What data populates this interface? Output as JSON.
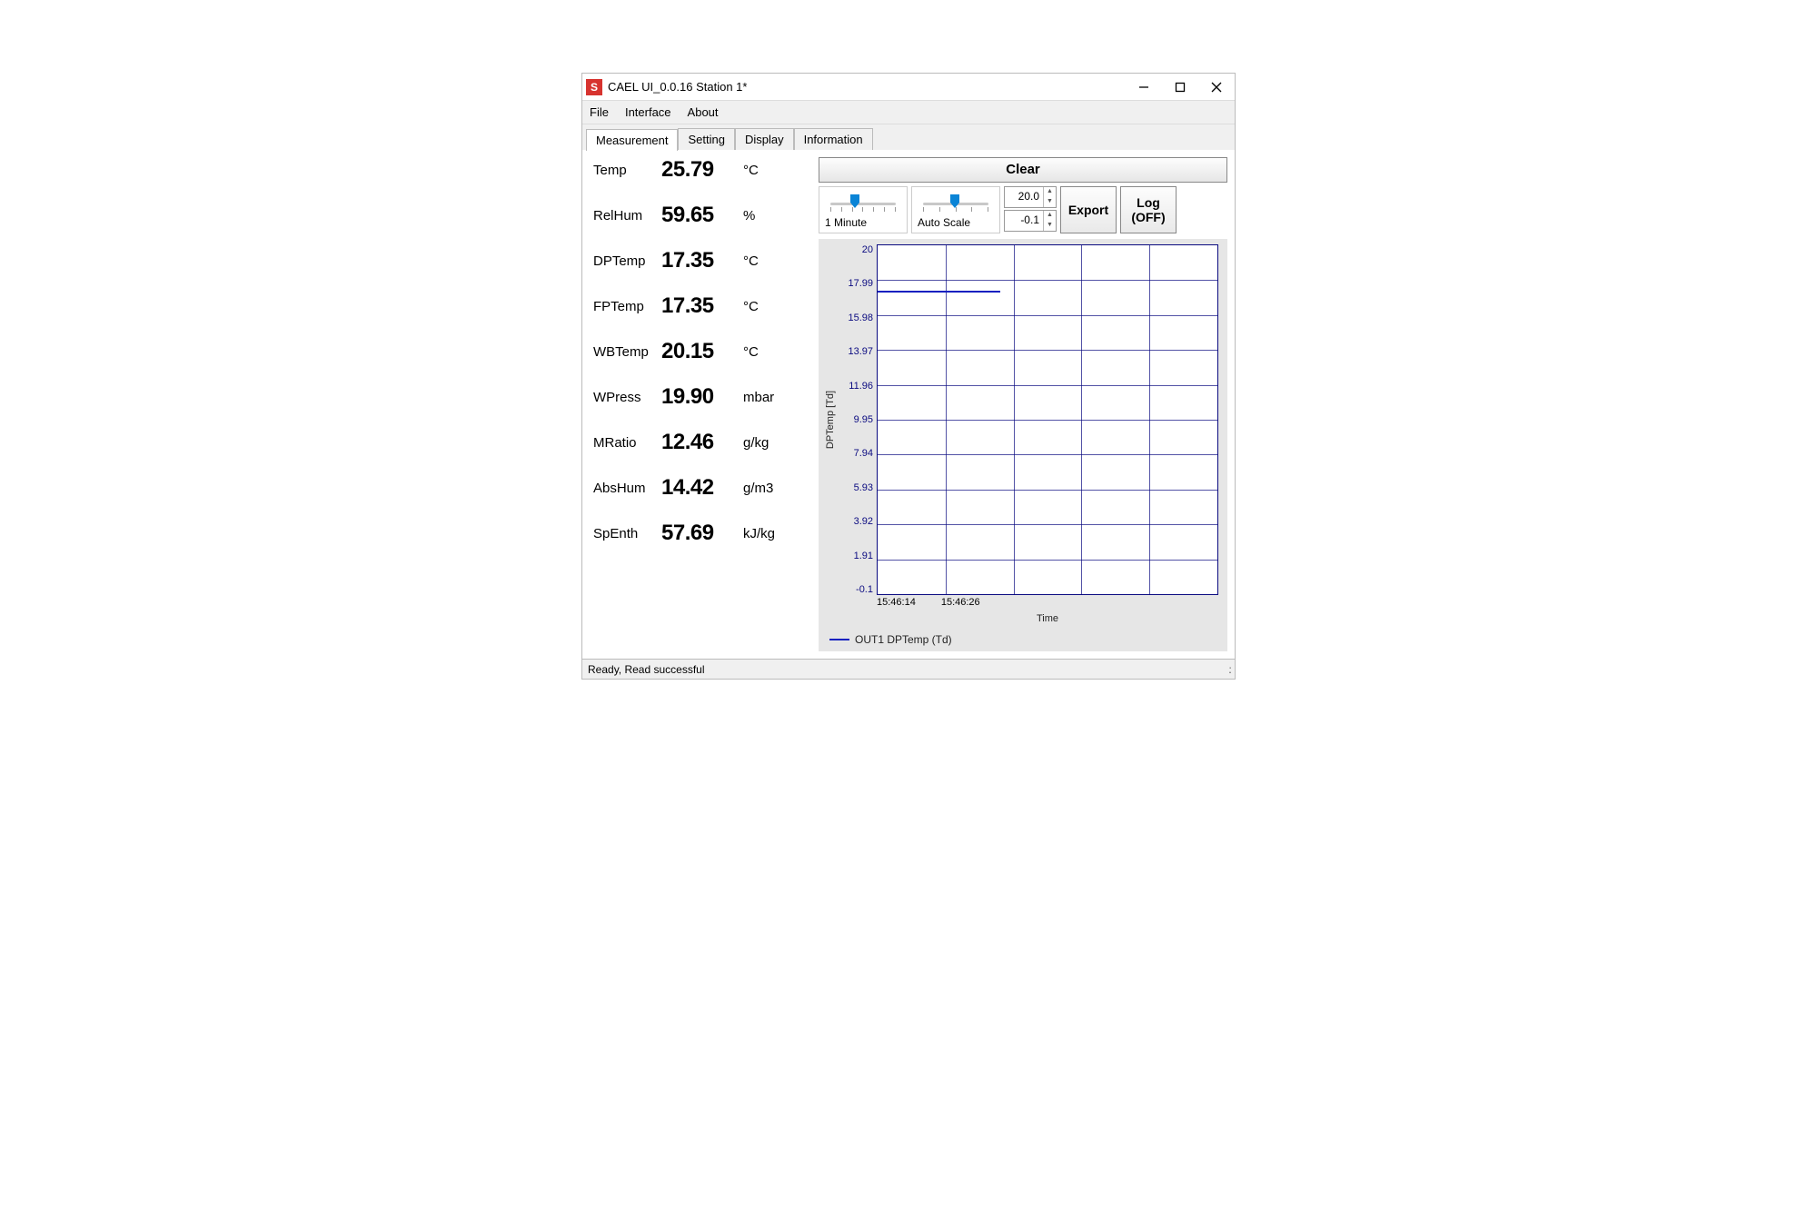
{
  "window": {
    "app_icon_letter": "S",
    "title": "CAEL UI_0.0.16  Station 1*"
  },
  "menu": {
    "items": [
      "File",
      "Interface",
      "About"
    ]
  },
  "tabs": {
    "items": [
      "Measurement",
      "Setting",
      "Display",
      "Information"
    ],
    "active": 0
  },
  "measurements": [
    {
      "label": "Temp",
      "value": "25.79",
      "unit": "°C"
    },
    {
      "label": "RelHum",
      "value": "59.65",
      "unit": "%"
    },
    {
      "label": "DPTemp",
      "value": "17.35",
      "unit": "°C"
    },
    {
      "label": "FPTemp",
      "value": "17.35",
      "unit": "°C"
    },
    {
      "label": "WBTemp",
      "value": "20.15",
      "unit": "°C"
    },
    {
      "label": "WPress",
      "value": "19.90",
      "unit": "mbar"
    },
    {
      "label": "MRatio",
      "value": "12.46",
      "unit": "g/kg"
    },
    {
      "label": "AbsHum",
      "value": "14.42",
      "unit": "g/m3"
    },
    {
      "label": "SpEnth",
      "value": "57.69",
      "unit": "kJ/kg"
    }
  ],
  "controls": {
    "clear": "Clear",
    "time_window": "1 Minute",
    "scale_mode": "Auto Scale",
    "y_max": "20.0",
    "y_min": "-0.1",
    "export": "Export",
    "log": "Log\n(OFF)"
  },
  "status": {
    "text": "Ready,   Read successful"
  },
  "chart_data": {
    "type": "line",
    "title": "",
    "ylabel": "DPTemp [Td]",
    "xlabel": "Time",
    "ylim": [
      -0.1,
      20
    ],
    "y_ticks": [
      "20",
      "17.99",
      "15.98",
      "13.97",
      "11.96",
      "9.95",
      "7.94",
      "5.93",
      "3.92",
      "1.91",
      "-0.1"
    ],
    "x_ticks": [
      "15:46:14",
      "15:46:26"
    ],
    "series": [
      {
        "name": "OUT1 DPTemp (Td)",
        "x": [
          "15:46:14",
          "15:46:26"
        ],
        "values": [
          17.35,
          17.35
        ]
      }
    ]
  }
}
